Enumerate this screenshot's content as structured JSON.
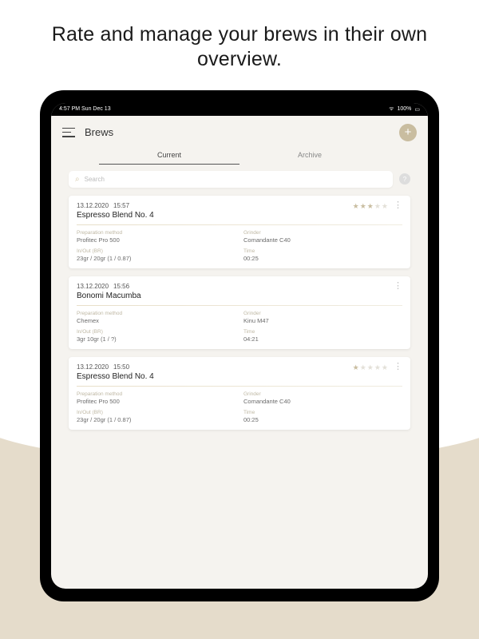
{
  "headline": "Rate and manage your brews in their own overview.",
  "statusbar": {
    "left": "4:57 PM  Sun Dec 13",
    "wifi": "⌃",
    "battery": "100%"
  },
  "header": {
    "title": "Brews"
  },
  "tabs": {
    "current": "Current",
    "archive": "Archive"
  },
  "search": {
    "placeholder": "Search"
  },
  "labels": {
    "prep": "Preparation method",
    "grinder": "Grinder",
    "inout": "In/Out (BR)",
    "time": "Time"
  },
  "brews": [
    {
      "date": "13.12.2020",
      "time": "15:57",
      "name": "Espresso Blend No. 4",
      "rating": 3,
      "prep": "Profitec Pro 500",
      "grinder": "Comandante C40",
      "inout": "23gr / 20gr (1 / 0.87)",
      "t": "00:25"
    },
    {
      "date": "13.12.2020",
      "time": "15:56",
      "name": "Bonomi Macumba",
      "rating": 0,
      "prep": "Chemex",
      "grinder": "Kinu M47",
      "inout": "3gr 10gr (1 / ?)",
      "t": "04:21"
    },
    {
      "date": "13.12.2020",
      "time": "15:50",
      "name": "Espresso Blend No. 4",
      "rating": 1,
      "prep": "Profitec Pro 500",
      "grinder": "Comandante C40",
      "inout": "23gr / 20gr (1 / 0.87)",
      "t": "00:25"
    }
  ]
}
